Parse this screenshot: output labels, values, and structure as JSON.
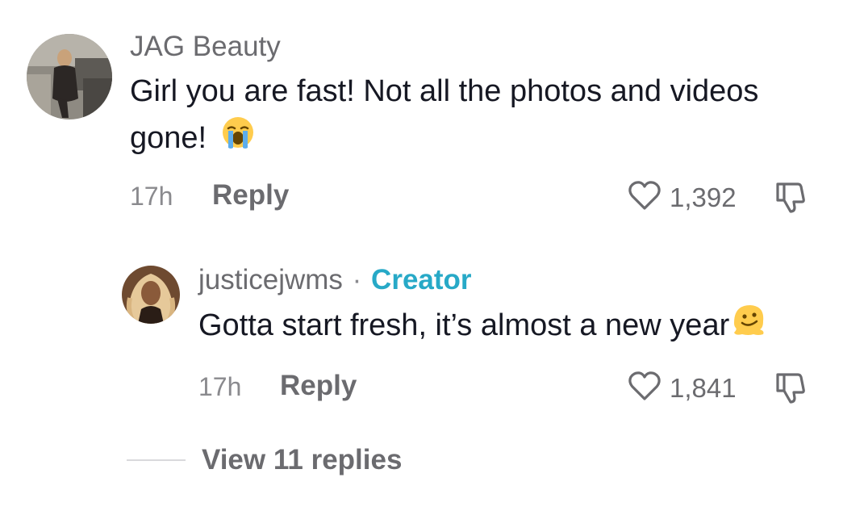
{
  "comments": [
    {
      "username": "JAG Beauty",
      "text_line1": "Girl you are fast! Not all the photos and videos",
      "text_line2": "gone!",
      "emoji": "loudly-crying-face",
      "time": "17h",
      "reply_label": "Reply",
      "likes": "1,392"
    },
    {
      "username": "justicejwms",
      "separator": "·",
      "badge": "Creator",
      "text": "Gotta start fresh, it’s almost a new year",
      "emoji": "melting-face",
      "time": "17h",
      "reply_label": "Reply",
      "likes": "1,841"
    }
  ],
  "view_replies": "View 11 replies",
  "colors": {
    "text": "#161823",
    "muted": "#6b6b6f",
    "creator_badge": "#27a9c7",
    "divider": "#d9d9dc"
  }
}
